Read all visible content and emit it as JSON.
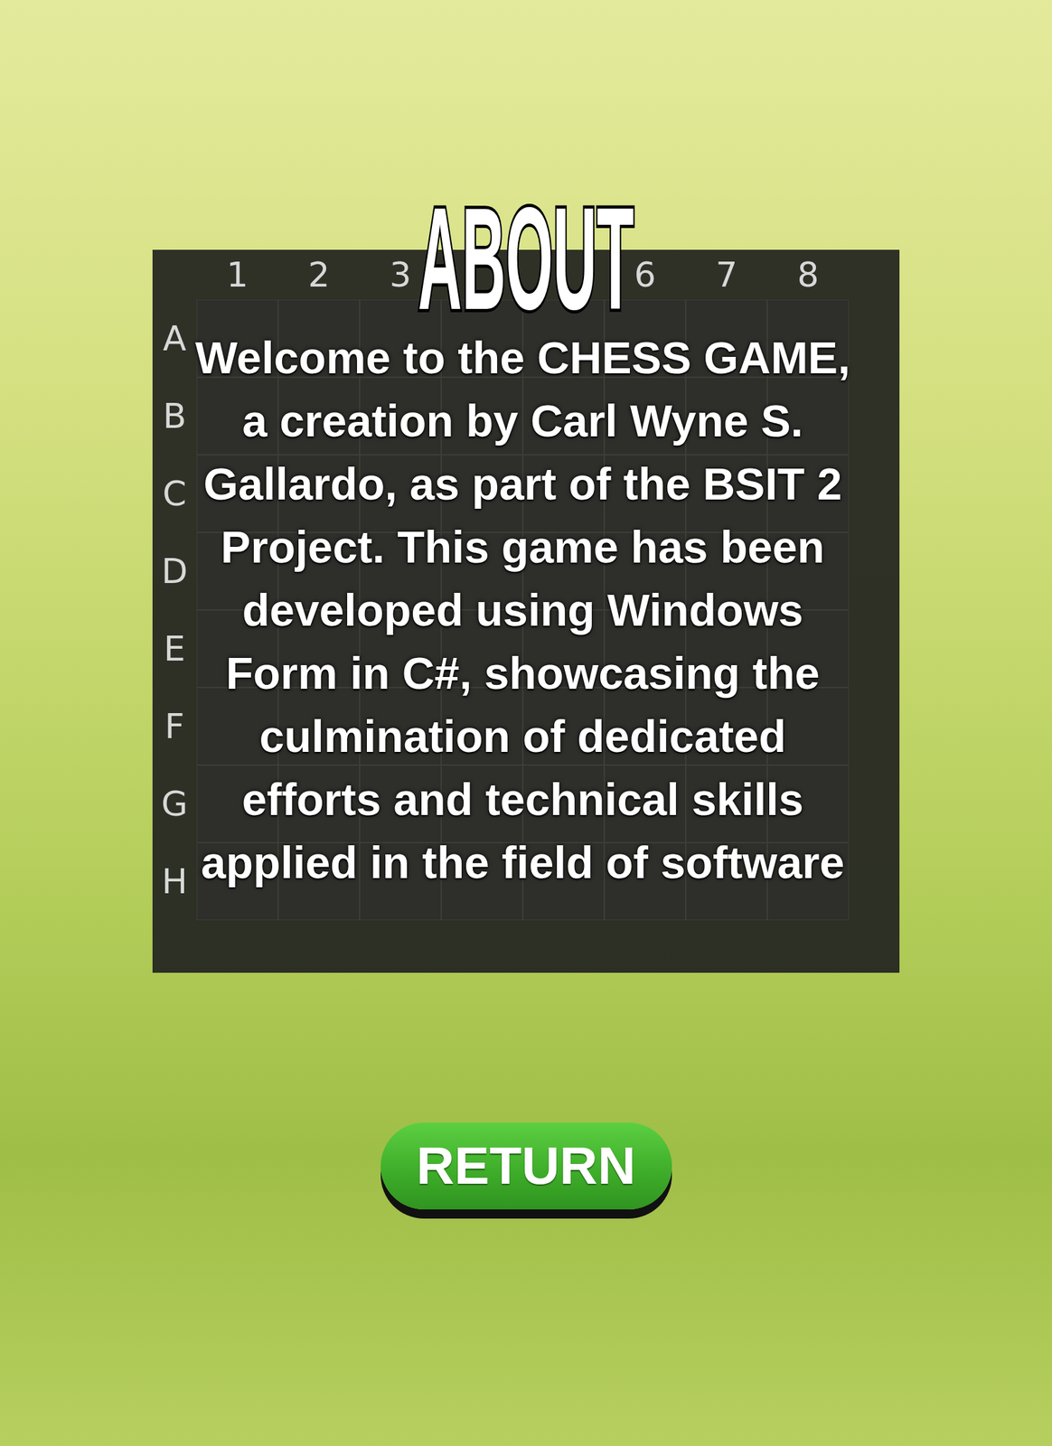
{
  "title": "ABOUT",
  "board": {
    "columns_left": [
      "1",
      "2",
      "3"
    ],
    "columns_right": [
      "6",
      "7",
      "8"
    ],
    "rows": [
      "A",
      "B",
      "C",
      "D",
      "E",
      "F",
      "G",
      "H"
    ]
  },
  "description": "Welcome to the CHESS GAME, a creation by Carl Wyne S. Gallardo, as part of the BSIT 2 Project. This game has been developed using Windows Form in C#, showcasing the culmination of dedicated efforts and technical skills applied in the field of software",
  "buttons": [
    {
      "label": "RETURN"
    }
  ]
}
